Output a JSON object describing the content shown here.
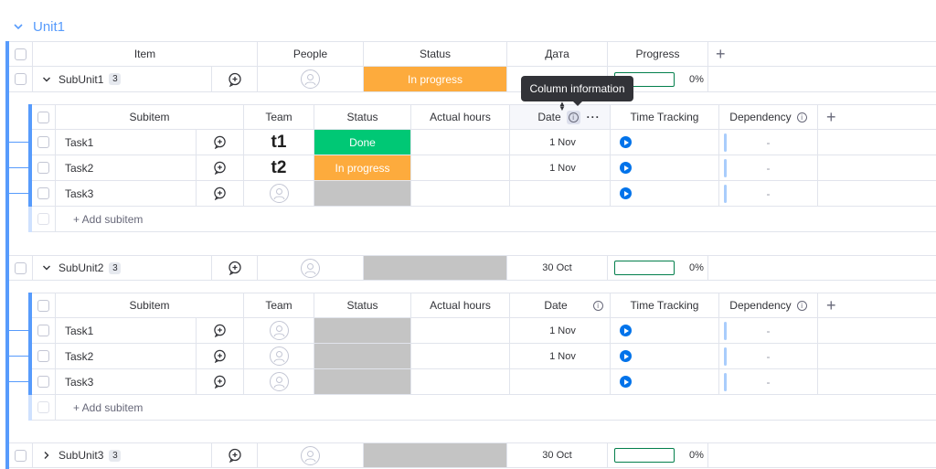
{
  "group": {
    "title": "Unit1"
  },
  "main_headers": {
    "item": "Item",
    "people": "People",
    "status": "Status",
    "date": "Дата",
    "progress": "Progress"
  },
  "sub_headers": {
    "subitem": "Subitem",
    "team": "Team",
    "status": "Status",
    "actual_hours": "Actual hours",
    "date": "Date",
    "time_tracking": "Time Tracking",
    "dependency": "Dependency"
  },
  "tooltip": {
    "text": "Column information"
  },
  "add_subitem_label": "+ Add subitem",
  "dependency_empty": "-",
  "items": [
    {
      "name": "SubUnit1",
      "count": "3",
      "status": "In progress",
      "date": "",
      "progress": "0%",
      "progress_value": 0,
      "subitems": [
        {
          "name": "Task1",
          "team": "t1",
          "status": "Done",
          "date": "1 Nov"
        },
        {
          "name": "Task2",
          "team": "t2",
          "status": "In progress",
          "date": "1 Nov"
        },
        {
          "name": "Task3",
          "team": "",
          "status": "",
          "date": ""
        }
      ]
    },
    {
      "name": "SubUnit2",
      "count": "3",
      "status": "",
      "date": "30 Oct",
      "progress": "0%",
      "progress_value": 0,
      "subitems": [
        {
          "name": "Task1",
          "team": "",
          "status": "",
          "date": "1 Nov"
        },
        {
          "name": "Task2",
          "team": "",
          "status": "",
          "date": "1 Nov"
        },
        {
          "name": "Task3",
          "team": "",
          "status": "",
          "date": ""
        }
      ]
    },
    {
      "name": "SubUnit3",
      "count": "3",
      "status": "",
      "date": "30 Oct",
      "progress": "0%",
      "progress_value": 0
    }
  ],
  "colors": {
    "accent": "#579bfc",
    "in_progress": "#fdab3d",
    "done": "#00c875",
    "empty_status": "#c4c4c4",
    "progress_border": "#037f4c",
    "play": "#0073ea"
  }
}
